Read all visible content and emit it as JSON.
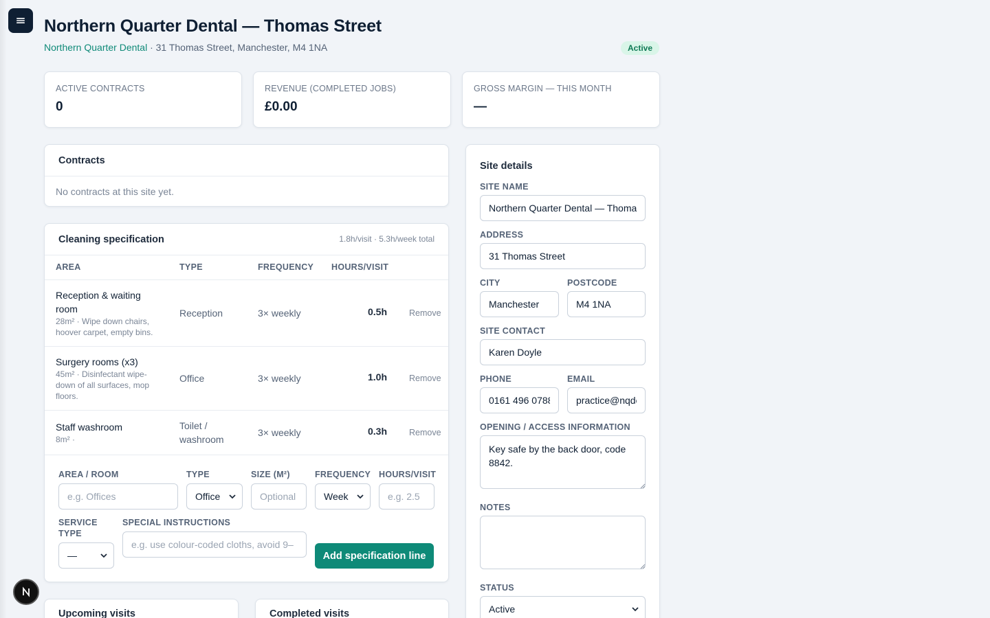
{
  "header": {
    "title": "Northern Quarter Dental — Thomas Street",
    "org": "Northern Quarter Dental",
    "address_line": " · 31 Thomas Street, Manchester, M4 1NA",
    "status": "Active"
  },
  "stats": [
    {
      "label": "ACTIVE CONTRACTS",
      "value": "0"
    },
    {
      "label": "REVENUE (COMPLETED JOBS)",
      "value": "£0.00"
    },
    {
      "label": "GROSS MARGIN — THIS MONTH",
      "value": "—"
    }
  ],
  "contracts": {
    "title": "Contracts",
    "empty": "No contracts at this site yet."
  },
  "spec": {
    "title": "Cleaning specification",
    "summary": "1.8h/visit · 5.3h/week total",
    "columns": [
      "AREA",
      "TYPE",
      "FREQUENCY",
      "HOURS/VISIT"
    ],
    "rows": [
      {
        "area": "Reception & waiting room",
        "desc": "28m² · Wipe down chairs, hoover carpet, empty bins.",
        "type": "Reception",
        "frequency": "3× weekly",
        "hours": "0.5h",
        "remove": "Remove"
      },
      {
        "area": "Surgery rooms (x3)",
        "desc": "45m² · Disinfectant wipe-down of all surfaces, mop floors.",
        "type": "Office",
        "frequency": "3× weekly",
        "hours": "1.0h",
        "remove": "Remove"
      },
      {
        "area": "Staff washroom",
        "desc": "8m² ·",
        "type": "Toilet / washroom",
        "frequency": "3× weekly",
        "hours": "0.3h",
        "remove": "Remove"
      }
    ],
    "form": {
      "area_label": "AREA / ROOM",
      "area_placeholder": "e.g. Offices",
      "type_label": "TYPE",
      "type_value": "Office",
      "size_label": "SIZE (M²)",
      "size_placeholder": "Optional",
      "frequency_label": "FREQUENCY",
      "frequency_value": "Week",
      "hours_label": "HOURS/VISIT",
      "hours_placeholder": "e.g. 2.5",
      "service_label": "SERVICE TYPE",
      "service_value": "—",
      "instructions_label": "SPECIAL INSTRUCTIONS",
      "instructions_placeholder": "e.g. use colour-coded cloths, avoid 9–",
      "add_button": "Add specification line"
    }
  },
  "visits": {
    "upcoming_title": "Upcoming visits",
    "completed_title": "Completed visits"
  },
  "site_details": {
    "title": "Site details",
    "site_name_label": "SITE NAME",
    "site_name": "Northern Quarter Dental — Thomas Street",
    "address_label": "ADDRESS",
    "address": "31 Thomas Street",
    "city_label": "CITY",
    "city": "Manchester",
    "postcode_label": "POSTCODE",
    "postcode": "M4 1NA",
    "contact_label": "SITE CONTACT",
    "contact": "Karen Doyle",
    "phone_label": "PHONE",
    "phone": "0161 496 0788",
    "email_label": "EMAIL",
    "email": "practice@nqdental.co.uk",
    "access_label": "OPENING / ACCESS INFORMATION",
    "access": "Key safe by the back door, code 8842.",
    "notes_label": "NOTES",
    "notes": "",
    "status_label": "STATUS",
    "status": "Active"
  },
  "icons": {
    "menu": "menu-icon",
    "framework": "next-logo-icon"
  }
}
